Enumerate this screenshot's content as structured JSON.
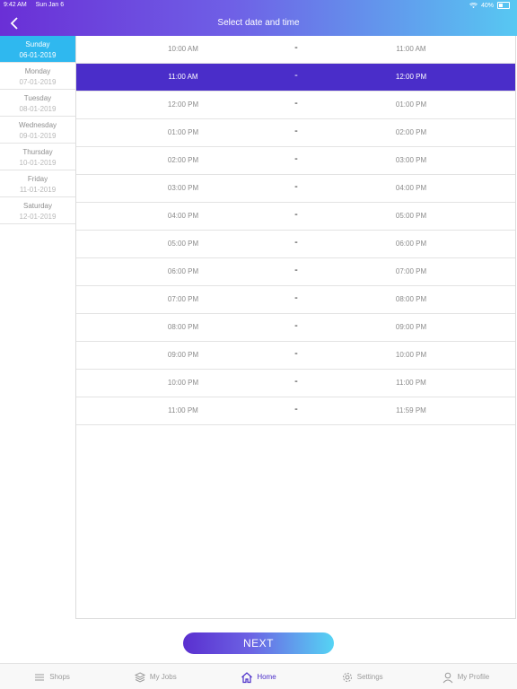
{
  "status_bar": {
    "time": "9:42 AM",
    "date": "Sun Jan 6",
    "battery": "40%"
  },
  "header": {
    "title": "Select date and time"
  },
  "days": [
    {
      "name": "Sunday",
      "date": "06-01-2019",
      "active": true
    },
    {
      "name": "Monday",
      "date": "07-01-2019"
    },
    {
      "name": "Tuesday",
      "date": "08-01-2019"
    },
    {
      "name": "Wednesday",
      "date": "09-01-2019"
    },
    {
      "name": "Thursday",
      "date": "10-01-2019"
    },
    {
      "name": "Friday",
      "date": "11-01-2019"
    },
    {
      "name": "Saturday",
      "date": "12-01-2019"
    }
  ],
  "slots": [
    {
      "start": "10:00 AM",
      "sep": "-",
      "end": "11:00 AM"
    },
    {
      "start": "11:00 AM",
      "sep": "-",
      "end": "12:00 PM",
      "selected": true
    },
    {
      "start": "12:00 PM",
      "sep": "-",
      "end": "01:00 PM"
    },
    {
      "start": "01:00 PM",
      "sep": "-",
      "end": "02:00 PM"
    },
    {
      "start": "02:00 PM",
      "sep": "-",
      "end": "03:00 PM"
    },
    {
      "start": "03:00 PM",
      "sep": "-",
      "end": "04:00 PM"
    },
    {
      "start": "04:00 PM",
      "sep": "-",
      "end": "05:00 PM"
    },
    {
      "start": "05:00 PM",
      "sep": "-",
      "end": "06:00 PM"
    },
    {
      "start": "06:00 PM",
      "sep": "-",
      "end": "07:00 PM"
    },
    {
      "start": "07:00 PM",
      "sep": "-",
      "end": "08:00 PM"
    },
    {
      "start": "08:00 PM",
      "sep": "-",
      "end": "09:00 PM"
    },
    {
      "start": "09:00 PM",
      "sep": "-",
      "end": "10:00 PM"
    },
    {
      "start": "10:00 PM",
      "sep": "-",
      "end": "11:00 PM"
    },
    {
      "start": "11:00 PM",
      "sep": "-",
      "end": "11:59 PM"
    }
  ],
  "next_button": {
    "label": "NEXT"
  },
  "tabbar": {
    "items": [
      {
        "label": "Shops",
        "icon": "menu-icon"
      },
      {
        "label": "My Jobs",
        "icon": "layers-icon"
      },
      {
        "label": "Home",
        "icon": "home-icon",
        "active": true
      },
      {
        "label": "Settings",
        "icon": "gear-icon"
      },
      {
        "label": "My Profile",
        "icon": "user-icon"
      }
    ]
  },
  "colors": {
    "header_gradient_start": "#6a2fd6",
    "header_gradient_end": "#57c8f2",
    "active_day": "#2fb8ef",
    "selected_slot": "#4a2dc9",
    "active_tab": "#4a2dc9"
  }
}
